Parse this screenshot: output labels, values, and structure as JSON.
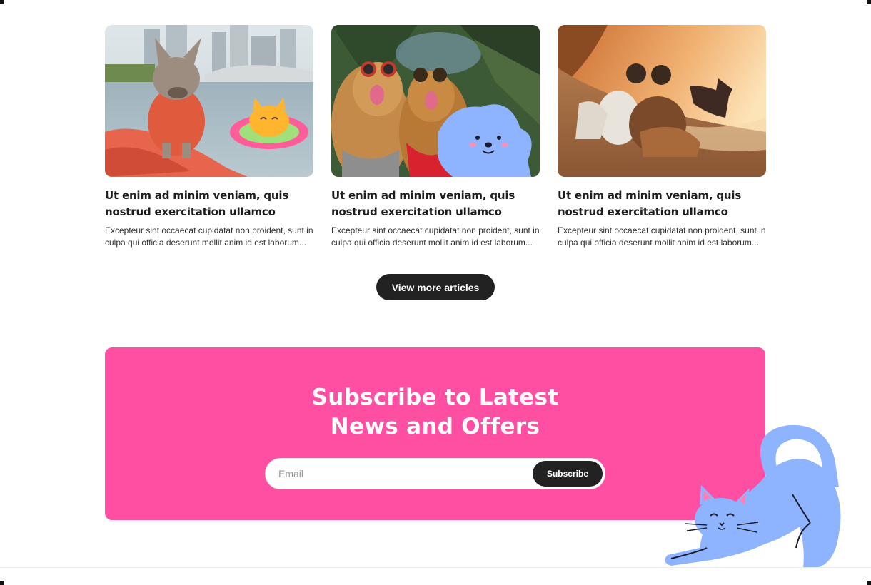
{
  "articles": [
    {
      "image": "french-bulldog-in-life-vest-on-kayak-with-cat-float-sticker",
      "title": "Ut enim ad minim veniam, quis nostrud exercitation ullamco",
      "excerpt": "Excepteur sint occaecat cupidatat non proident, sunt in culpa qui officia deserunt mollit anim id est laborum..."
    },
    {
      "image": "two-dogs-in-sunglasses-with-blue-poodle-sticker",
      "title": "Ut enim ad minim veniam, quis nostrud exercitation ullamco",
      "excerpt": "Excepteur sint occaecat cupidatat non proident, sunt in culpa qui officia deserunt mollit anim id est laborum..."
    },
    {
      "image": "people-with-dogs-at-beach-sunset",
      "title": "Ut enim ad minim veniam, quis nostrud exercitation ullamco",
      "excerpt": "Excepteur sint occaecat cupidatat non proident, sunt in culpa qui officia deserunt mollit anim id est laborum..."
    }
  ],
  "view_more_label": "View more articles",
  "subscribe": {
    "title": "Subscribe to Latest News and Offers",
    "email_placeholder": "Email",
    "button_label": "Subscribe",
    "background_color": "#ff4fa3"
  },
  "decoration": "stretching-blue-cat-illustration"
}
